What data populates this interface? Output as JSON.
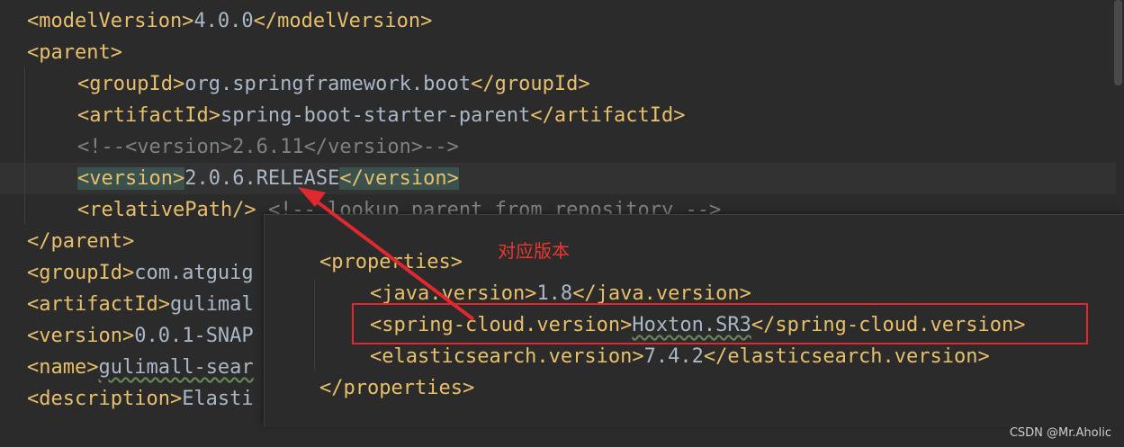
{
  "editor": {
    "lines": [
      {
        "indent": "",
        "open": "<modelVersion>",
        "text": "4.0.0",
        "close": "</modelVersion>"
      },
      {
        "indent": "",
        "open": "<parent>",
        "text": "",
        "close": ""
      },
      {
        "indent": "    ",
        "open": "<groupId>",
        "text": "org.springframework.boot",
        "close": "</groupId>"
      },
      {
        "indent": "    ",
        "open": "<artifactId>",
        "text": "spring-boot-starter-parent",
        "close": "</artifactId>"
      },
      {
        "indent": "    ",
        "comment": "<!--<version>2.6.11</version>-->"
      },
      {
        "indent": "    ",
        "open": "<version>",
        "text": "2.0.6.RELEASE",
        "close": "</version>"
      },
      {
        "indent": "    ",
        "open": "<relativePath/>",
        "text": " ",
        "comment2": "<!-- lookup parent from repository -->"
      },
      {
        "indent": "",
        "open": "</parent>",
        "text": "",
        "close": ""
      },
      {
        "indent": "",
        "open": "<groupId>",
        "text": "com.atguig",
        "close": ""
      },
      {
        "indent": "",
        "open": "<artifactId>",
        "text": "gulimal",
        "close": ""
      },
      {
        "indent": "",
        "open": "<version>",
        "text": "0.0.1-SNAP",
        "close": ""
      },
      {
        "indent": "",
        "open": "<name>",
        "text": "gulimall-sear",
        "close": ""
      },
      {
        "indent": "",
        "open": "<description>",
        "text": "Elasti",
        "close": ""
      }
    ]
  },
  "overlay": {
    "annotation": "对应版本",
    "lines": [
      {
        "open": "<properties>",
        "text": "",
        "close": ""
      },
      {
        "open": "<java.version>",
        "text": "1.8",
        "close": "</java.version>"
      },
      {
        "open": "<spring-cloud.version>",
        "text": "Hoxton.SR3",
        "close": "</spring-cloud.version>"
      },
      {
        "open": "<elasticsearch.version>",
        "text": "7.4.2",
        "close": "</elasticsearch.version>"
      },
      {
        "open": "</properties>",
        "text": "",
        "close": ""
      }
    ]
  },
  "watermark": "CSDN @Mr.Aholic",
  "colors": {
    "tag": "#e8bf6a",
    "text": "#a9b7c6",
    "comment": "#808080",
    "annotation": "#e8372f"
  }
}
